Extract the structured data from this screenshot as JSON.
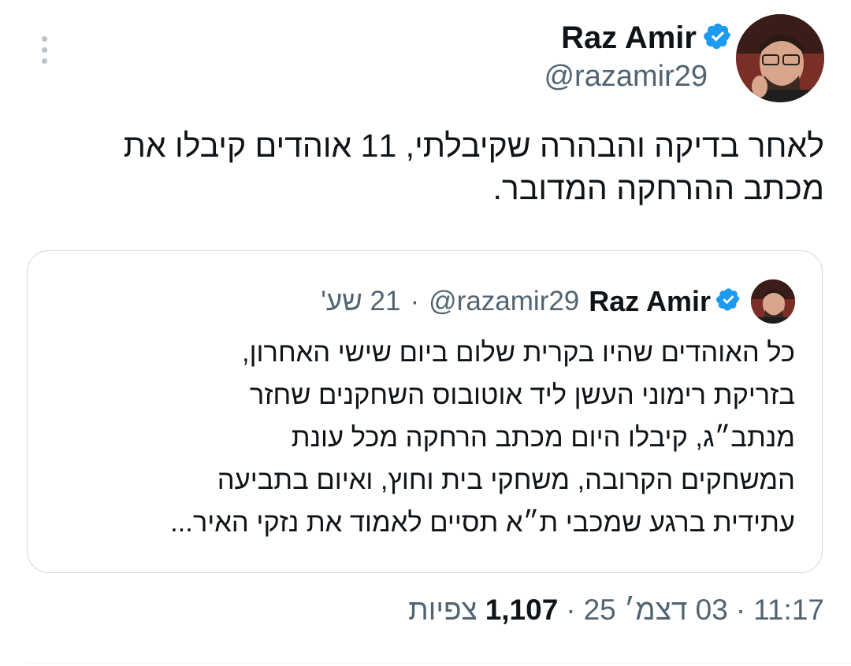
{
  "author": {
    "name": "Raz Amir",
    "handle": "@razamir29",
    "verified": true
  },
  "tweet": {
    "text": "לאחר בדיקה והבהרה שקיבלתי, 11 אוהדים קיבלו את מכתב ההרחקה המדובר."
  },
  "quoted_tweet": {
    "name": "Raz Amir",
    "handle": "@razamir29",
    "separator": "·",
    "time": "21 שע'",
    "verified": true,
    "lines": [
      "כל האוהדים שהיו בקרית שלום ביום שישי האחרון,",
      "בזריקת רימוני העשן ליד אוטובוס השחקנים שחזר",
      "מנתב״ג, קיבלו היום מכתב הרחקה מכל עונת",
      "המשחקים הקרובה, משחקי בית וחוץ, ואיום בתביעה",
      "עתידית ברגע שמכבי ת״א תסיים לאמוד את נזקי האיר..."
    ]
  },
  "meta": {
    "time": "11:17",
    "separator": "·",
    "date": "03 דצמ׳ 25",
    "views_count": "1,107",
    "views_label": "צפיות"
  },
  "icons": {
    "more": "more-vertical-icon",
    "verified": "verified-badge-icon"
  },
  "colors": {
    "verified_blue": "#1d9bf0",
    "text_primary": "#0f1419",
    "text_secondary": "#536471",
    "border": "#cfd9de"
  }
}
